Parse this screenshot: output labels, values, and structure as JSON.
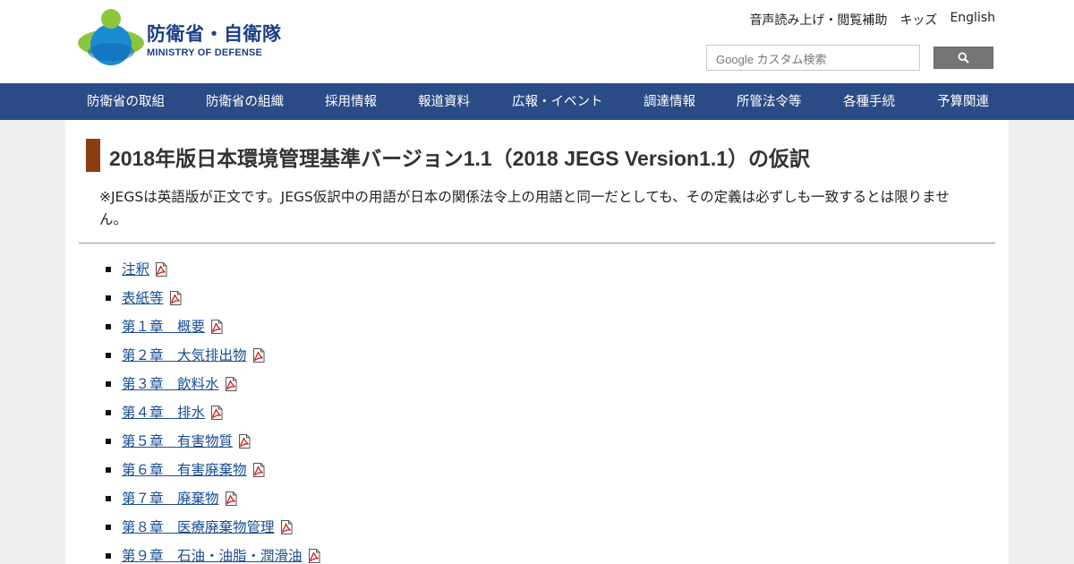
{
  "header": {
    "logo_jp": "防衛省・自衛隊",
    "logo_en": "MINISTRY OF DEFENSE",
    "util_links": [
      "音声読み上げ・閲覧補助",
      "キッズ",
      "English"
    ],
    "search_placeholder": "Google カスタム検索",
    "search_icon": "search-icon"
  },
  "nav": {
    "items": [
      "防衛省の取組",
      "防衛省の組織",
      "採用情報",
      "報道資料",
      "広報・イベント",
      "調達情報",
      "所管法令等",
      "各種手続",
      "予算関連"
    ]
  },
  "main": {
    "title": "2018年版日本環境管理基準バージョン1.1（2018 JEGS Version1.1）の仮訳",
    "note": "※JEGSは英語版が正文です。JEGS仮訳中の用語が日本の関係法令上の用語と同一だとしても、その定義は必ずしも一致するとは限りません。",
    "documents": [
      {
        "label": "注釈",
        "icon": "pdf-icon"
      },
      {
        "label": "表紙等",
        "icon": "pdf-icon"
      },
      {
        "label": "第１章　概要",
        "icon": "pdf-icon"
      },
      {
        "label": "第２章　大気排出物",
        "icon": "pdf-icon"
      },
      {
        "label": "第３章　飲料水",
        "icon": "pdf-icon"
      },
      {
        "label": "第４章　排水",
        "icon": "pdf-icon"
      },
      {
        "label": "第５章　有害物質",
        "icon": "pdf-icon"
      },
      {
        "label": "第６章　有害廃棄物",
        "icon": "pdf-icon"
      },
      {
        "label": "第７章　廃棄物",
        "icon": "pdf-icon"
      },
      {
        "label": "第８章　医療廃棄物管理",
        "icon": "pdf-icon"
      },
      {
        "label": "第９章　石油・油脂・潤滑油",
        "icon": "pdf-icon"
      }
    ]
  },
  "colors": {
    "nav_bg": "#2b4b86",
    "title_accent": "#8b3d12",
    "link": "#1a4e92",
    "logo_blue": "#1a3f86",
    "logo_green": "#8cc63f"
  }
}
